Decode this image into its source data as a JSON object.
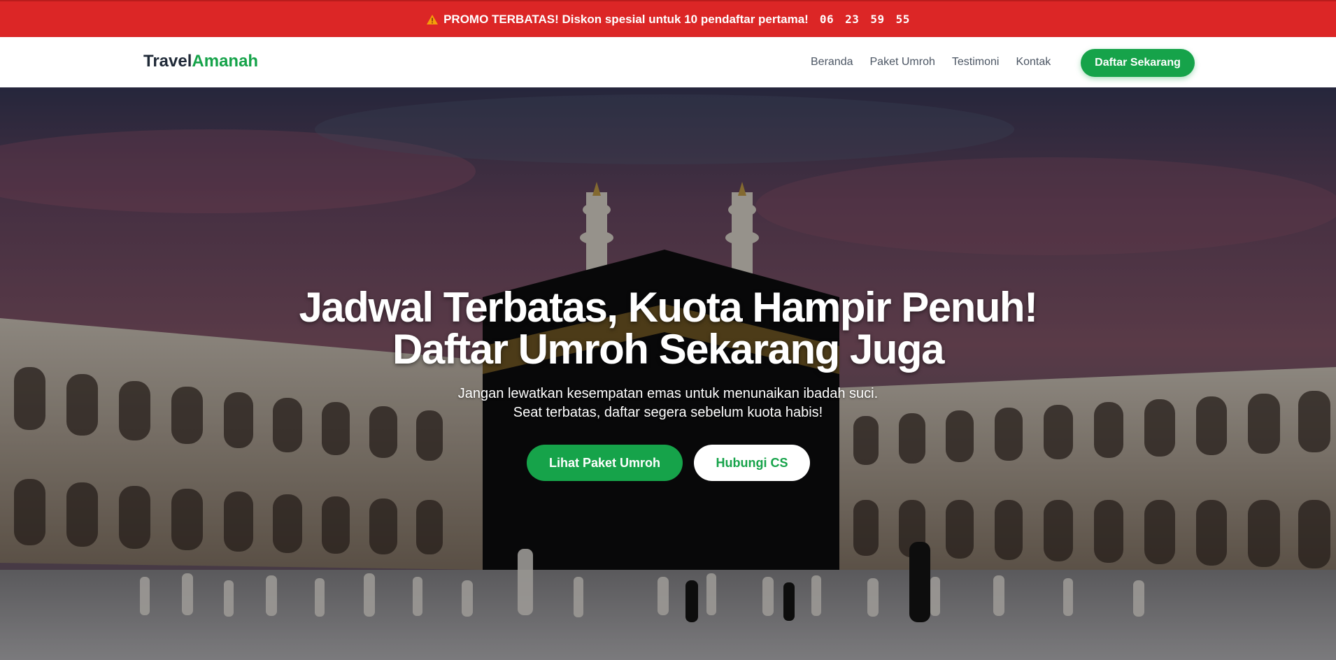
{
  "promo": {
    "icon": "warning-icon",
    "text": "PROMO TERBATAS! Diskon spesial untuk 10 pendaftar pertama!",
    "countdown": [
      "06",
      "23",
      "59",
      "55"
    ]
  },
  "navbar": {
    "brand_part1": "Travel",
    "brand_part2": "Amanah",
    "links": [
      "Beranda",
      "Paket Umroh",
      "Testimoni",
      "Kontak"
    ],
    "cta": "Daftar Sekarang"
  },
  "hero": {
    "title_line1": "Jadwal Terbatas, Kuota Hampir Penuh!",
    "title_line2": "Daftar Umroh Sekarang Juga",
    "subtitle_line1": "Jangan lewatkan kesempatan emas untuk menunaikan ibadah suci.",
    "subtitle_line2": "Seat terbatas, daftar segera sebelum kuota habis!",
    "primary_button": "Lihat Paket Umroh",
    "secondary_button": "Hubungi CS"
  },
  "colors": {
    "promo_bg": "#dc2626",
    "brand_green": "#16a34a",
    "text_dark": "#1f2937"
  }
}
